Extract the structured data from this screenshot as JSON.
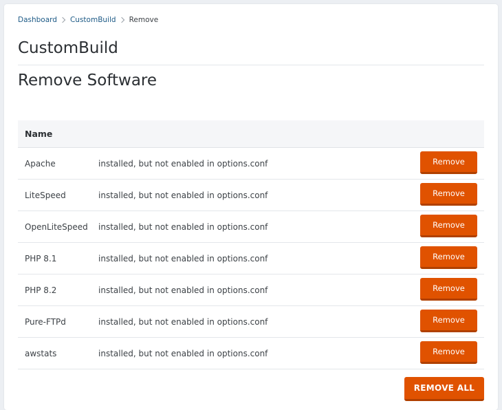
{
  "breadcrumb": {
    "items": [
      "Dashboard",
      "CustomBuild"
    ],
    "current": "Remove"
  },
  "page_title": "CustomBuild",
  "section_title": "Remove Software",
  "table": {
    "header_name": "Name",
    "rows": [
      {
        "name": "Apache",
        "status": "installed, but not enabled in options.conf",
        "action": "Remove"
      },
      {
        "name": "LiteSpeed",
        "status": "installed, but not enabled in options.conf",
        "action": "Remove"
      },
      {
        "name": "OpenLiteSpeed",
        "status": "installed, but not enabled in options.conf",
        "action": "Remove"
      },
      {
        "name": "PHP 8.1",
        "status": "installed, but not enabled in options.conf",
        "action": "Remove"
      },
      {
        "name": "PHP 8.2",
        "status": "installed, but not enabled in options.conf",
        "action": "Remove"
      },
      {
        "name": "Pure-FTPd",
        "status": "installed, but not enabled in options.conf",
        "action": "Remove"
      },
      {
        "name": "awstats",
        "status": "installed, but not enabled in options.conf",
        "action": "Remove"
      }
    ]
  },
  "remove_all_label": "REMOVE ALL",
  "colors": {
    "accent": "#e05200",
    "link": "#1d5a86",
    "background": "#eceff3"
  }
}
